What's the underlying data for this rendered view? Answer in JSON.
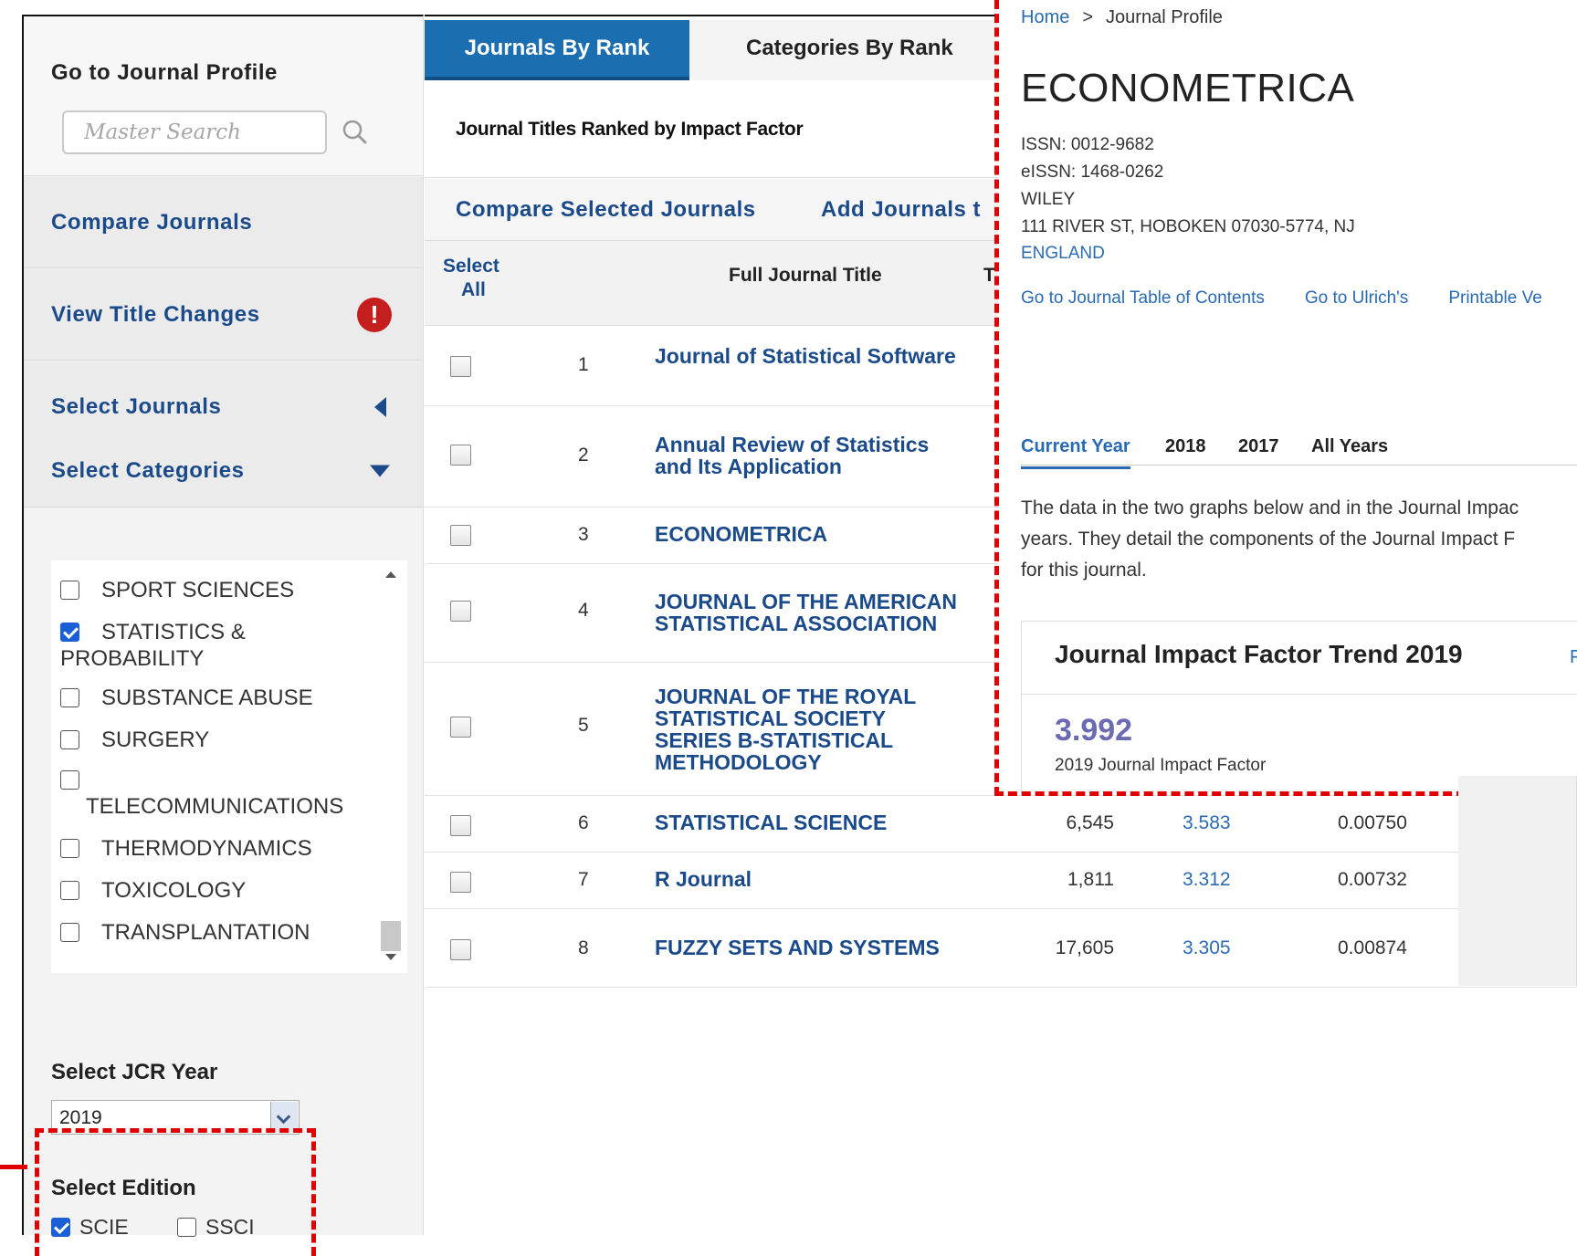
{
  "sidebar": {
    "go_profile_title": "Go to Journal Profile",
    "search_placeholder": "Master Search",
    "items": [
      {
        "label": "Compare Journals"
      },
      {
        "label": "View Title Changes",
        "badge": "!"
      },
      {
        "label": "Select Journals"
      },
      {
        "label": "Select Categories"
      }
    ],
    "categories": [
      {
        "label": "SPORT SCIENCES",
        "checked": false
      },
      {
        "label": "STATISTICS &",
        "label2": "PROBABILITY",
        "checked": true
      },
      {
        "label": "SUBSTANCE ABUSE",
        "checked": false
      },
      {
        "label": "SURGERY",
        "checked": false
      },
      {
        "label": "TELECOMMUNICATIONS",
        "checked": false
      },
      {
        "label": "THERMODYNAMICS",
        "checked": false
      },
      {
        "label": "TOXICOLOGY",
        "checked": false
      },
      {
        "label": "TRANSPLANTATION",
        "checked": false
      }
    ],
    "jcr_year_title": "Select JCR Year",
    "jcr_year_value": "2019",
    "edition_title": "Select Edition",
    "editions": [
      {
        "label": "SCIE",
        "checked": true
      },
      {
        "label": "SSCI",
        "checked": false
      }
    ]
  },
  "main": {
    "tabs": [
      {
        "label": "Journals By Rank",
        "active": true
      },
      {
        "label": "Categories By Rank",
        "active": false
      }
    ],
    "subtitle": "Journal Titles Ranked by Impact Factor",
    "actions": [
      "Compare Selected Journals",
      "Add Journals t"
    ],
    "headers": {
      "select": "Select",
      "select2": "All",
      "title": "Full Journal Title",
      "total": "T"
    },
    "rows": [
      {
        "rank": "1",
        "title": "Journal of Statistical Software",
        "cites": "",
        "jif": "",
        "eig": ""
      },
      {
        "rank": "2",
        "title": "Annual Review of Statistics and Its Application",
        "cites": "",
        "jif": "",
        "eig": ""
      },
      {
        "rank": "3",
        "title": "ECONOMETRICA",
        "cites": "",
        "jif": "",
        "eig": ""
      },
      {
        "rank": "4",
        "title": "JOURNAL OF THE AMERICAN STATISTICAL ASSOCIATION",
        "cites": "",
        "jif": "",
        "eig": ""
      },
      {
        "rank": "5",
        "title": "JOURNAL OF THE ROYAL STATISTICAL SOCIETY SERIES B-STATISTICAL METHODOLOGY",
        "cites": "",
        "jif": "",
        "eig": ""
      },
      {
        "rank": "6",
        "title": "STATISTICAL SCIENCE",
        "cites": "6,545",
        "jif": "3.583",
        "eig": "0.00750"
      },
      {
        "rank": "7",
        "title": "R Journal",
        "cites": "1,811",
        "jif": "3.312",
        "eig": "0.00732"
      },
      {
        "rank": "8",
        "title": "FUZZY SETS AND SYSTEMS",
        "cites": "17,605",
        "jif": "3.305",
        "eig": "0.00874"
      }
    ]
  },
  "profile": {
    "breadcrumb_home": "Home",
    "breadcrumb_sep": ">",
    "breadcrumb_current": "Journal Profile",
    "title": "ECONOMETRICA",
    "issn": "ISSN: 0012-9682",
    "eissn": "eISSN: 1468-0262",
    "publisher": "WILEY",
    "address": "111 RIVER ST, HOBOKEN 07030-5774, NJ",
    "country": "ENGLAND",
    "links": [
      "Go to Journal Table of Contents",
      "Go to Ulrich's",
      "Printable Ve"
    ],
    "year_tabs": [
      "Current Year",
      "2018",
      "2017",
      "All Years"
    ],
    "para_lines": [
      "The data in the two graphs below and in the Journal Impac",
      "years. They detail the components of the Journal Impact F",
      "for this journal."
    ],
    "trend_title": "Journal Impact Factor Trend 2019",
    "trend_link": "F",
    "trend_value": "3.992",
    "trend_caption": "2019 Journal Impact Factor"
  }
}
